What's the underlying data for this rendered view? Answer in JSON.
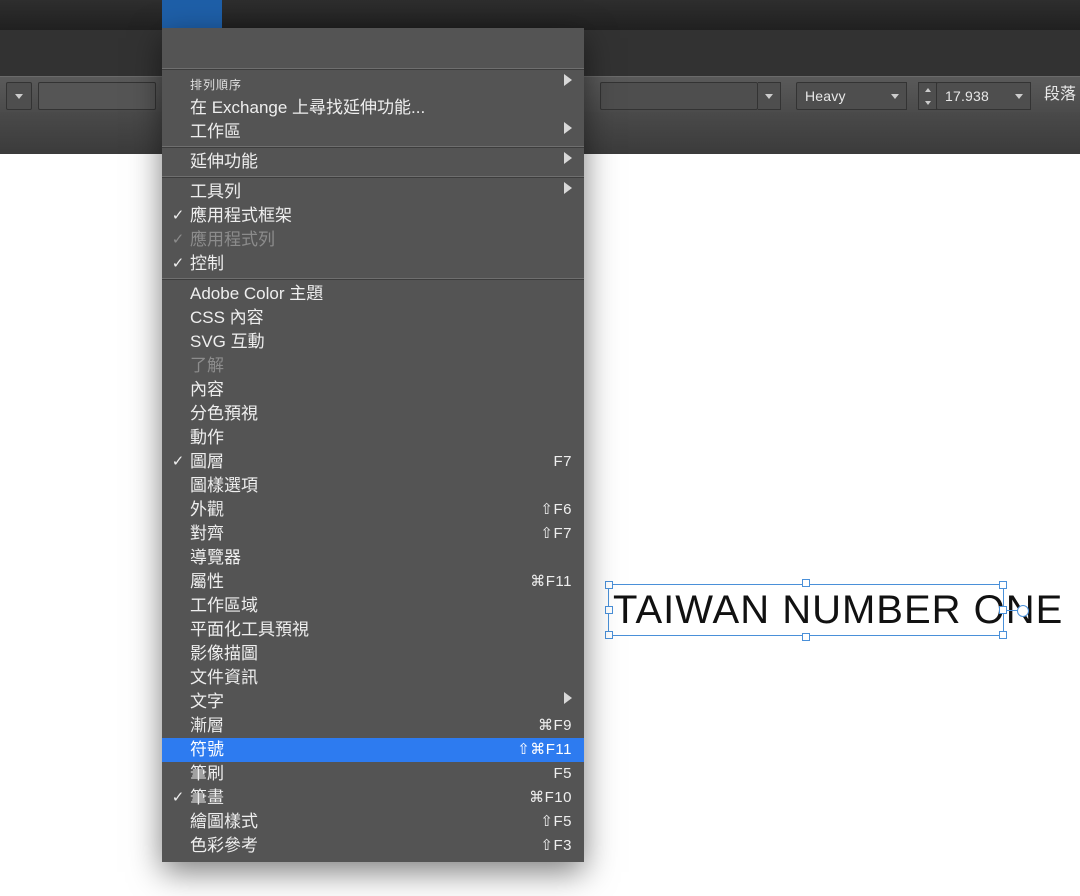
{
  "optionbar": {
    "font_weight": "Heavy",
    "font_size": "17.938",
    "right_label": "段落"
  },
  "menu": {
    "blurry_tiny": "排列順序",
    "exchange": "在 Exchange 上尋找延伸功能...",
    "workspace": "工作區",
    "extensions": "延伸功能",
    "toolbar": "工具列",
    "app_frame": "應用程式框架",
    "app_bar": "應用程式列",
    "control": "控制",
    "adobe_color": "Adobe Color 主題",
    "css": "CSS 內容",
    "svg": "SVG 互動",
    "about": "了解",
    "content": "內容",
    "sep_preview": "分色預視",
    "actions": "動作",
    "layers": "圖層",
    "pattern_opts": "圖樣選項",
    "appearance": "外觀",
    "align": "對齊",
    "navigator": "導覽器",
    "attributes": "屬性",
    "artboards": "工作區域",
    "flattener": "平面化工具預視",
    "image_trace": "影像描圖",
    "doc_info": "文件資訊",
    "type": "文字",
    "gradient": "漸層",
    "glyphs": "符號",
    "brushes": "筆刷",
    "strokes": "筆畫",
    "graphic_styles": "繪圖樣式",
    "color_guide": "色彩參考",
    "sc": {
      "layers": "F7",
      "appearance": "⇧F6",
      "align": "⇧F7",
      "attributes": "⌘F11",
      "gradient": "⌘F9",
      "glyphs": "⇧⌘F11",
      "brushes": "F5",
      "strokes": "⌘F10",
      "graphic_styles": "⇧F5",
      "color_guide": "⇧F3"
    }
  },
  "canvas": {
    "text": "TAIWAN NUMBER ONE"
  }
}
